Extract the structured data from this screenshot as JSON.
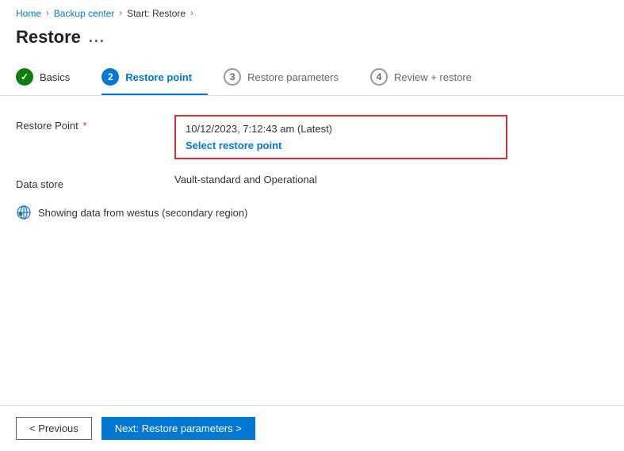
{
  "breadcrumb": {
    "home": "Home",
    "backup_center": "Backup center",
    "current": "Start: Restore",
    "chevron": "›"
  },
  "page": {
    "title": "Restore",
    "ellipsis": "..."
  },
  "tabs": [
    {
      "id": "basics",
      "label": "Basics",
      "step": "✓",
      "state": "completed"
    },
    {
      "id": "restore-point",
      "label": "Restore point",
      "step": "2",
      "state": "active"
    },
    {
      "id": "restore-parameters",
      "label": "Restore parameters",
      "step": "3",
      "state": "inactive"
    },
    {
      "id": "review-restore",
      "label": "Review + restore",
      "step": "4",
      "state": "inactive"
    }
  ],
  "form": {
    "restore_point_label": "Restore Point",
    "restore_point_required": "*",
    "restore_point_value": "10/12/2023, 7:12:43 am (Latest)",
    "select_link_label": "Select restore point",
    "data_store_label": "Data store",
    "data_store_value": "Vault-standard and Operational",
    "info_text": "Showing data from westus (secondary region)"
  },
  "footer": {
    "previous_label": "< Previous",
    "next_label": "Next: Restore parameters >"
  },
  "colors": {
    "accent": "#0078d4",
    "success": "#107c10",
    "error": "#d13438"
  }
}
